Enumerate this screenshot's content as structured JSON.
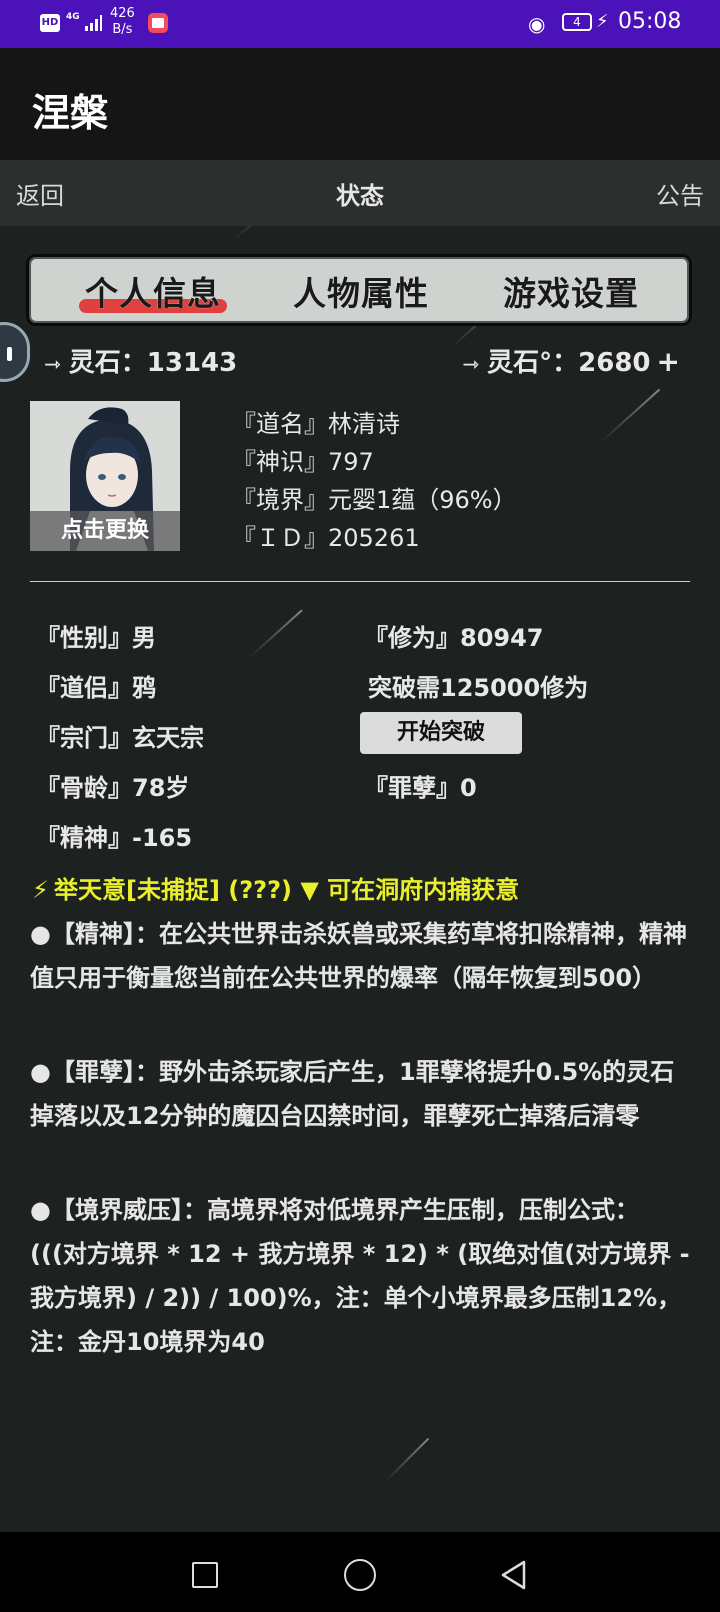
{
  "status_bar": {
    "hd": "HD",
    "network": "4G",
    "speed_value": "426",
    "speed_unit": "B/s",
    "battery": "4",
    "time": "05:08"
  },
  "app": {
    "title": "涅槃"
  },
  "nav": {
    "back": "返回",
    "title": "状态",
    "notice": "公告"
  },
  "tabs": [
    {
      "label": "个人信息",
      "active": true
    },
    {
      "label": "人物属性",
      "active": false
    },
    {
      "label": "游戏设置",
      "active": false
    }
  ],
  "currency": {
    "left": "灵石：13143",
    "right": "灵石°：2680",
    "plus": "+"
  },
  "avatar": {
    "caption": "点击更换"
  },
  "profile": [
    "『道名』林清诗",
    "『神识』797",
    "『境界』元婴1蕴（96%）",
    "『ＩＤ』205261"
  ],
  "attrs_left": [
    "『性别』男",
    "『道侣』鸦",
    "『宗门』玄天宗",
    "『骨龄』78岁",
    "『精神』-165"
  ],
  "attrs_right": {
    "cultivation": "『修为』80947",
    "breakthrough_need": "突破需125000修为",
    "breakthrough_button": "开始突破",
    "sin": "『罪孽』0"
  },
  "heaven_intent": "举天意[未捕捉]  (???)  ▼  可在洞府内捕获意",
  "descriptions": [
    "●【精神】：在公共世界击杀妖兽或采集药草将扣除精神，精神值只用于衡量您当前在公共世界的爆率（隔年恢复到500）",
    "●【罪孽】：野外击杀玩家后产生，1罪孽将提升0.5%的灵石掉落以及12分钟的魔囚台囚禁时间，罪孽死亡掉落后清零",
    "●【境界威压】：高境界将对低境界产生压制，压制公式：(((对方境界 * 12 + 我方境界 * 12) * (取绝对值(对方境界 - 我方境界) / 2)) / 100)%，注：单个小境界最多压制12%，注：金丹10境界为40"
  ],
  "colors": {
    "status_bar": "#4a12b8",
    "background": "#1d2120",
    "tab_highlight": "#e0413f",
    "heaven_text": "#e9ef2a"
  },
  "icons": {
    "currency": "arrow-pair-icon",
    "heaven": "lightning-icon",
    "dropdown": "triangle-down-icon"
  }
}
